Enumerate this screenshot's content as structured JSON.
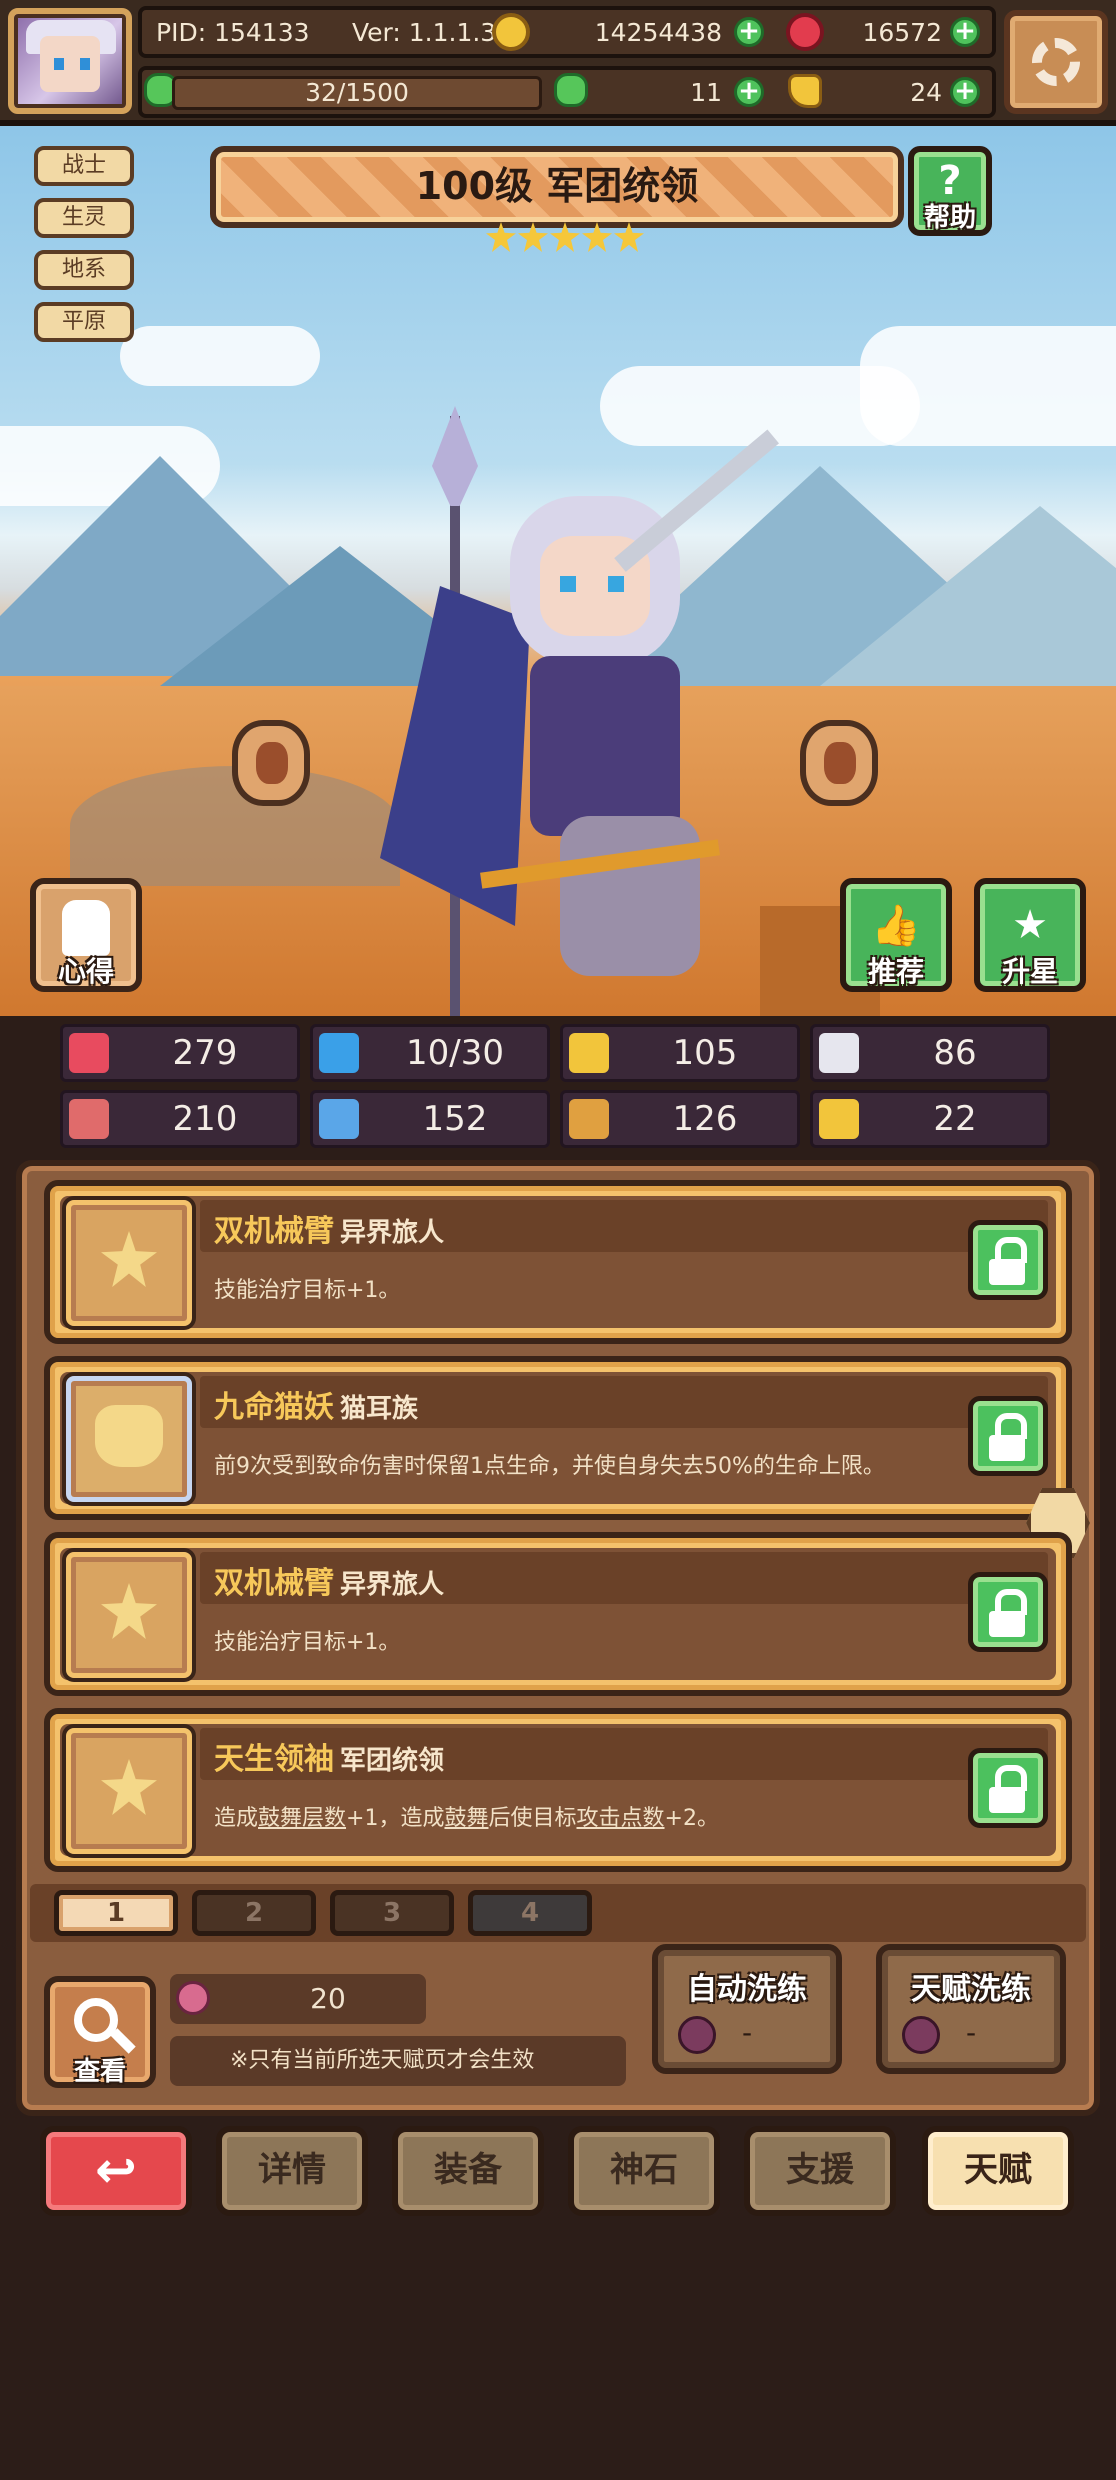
{
  "topbar": {
    "pid": "PID: 154133",
    "version": "Ver: 1.1.1.3",
    "gold": "14254438",
    "gems": "16572",
    "exp": "32/1500",
    "clover": "11",
    "tickets": "24"
  },
  "tags": [
    "战士",
    "生灵",
    "地系",
    "平原"
  ],
  "hero": {
    "title": "100级  军团统领",
    "stars": 5
  },
  "scene_buttons": {
    "help": "帮助",
    "insight": "心得",
    "recommend": "推荐",
    "star_up": "升星",
    "help_icon": "?",
    "recommend_icon": "👍",
    "star_up_icon": "★"
  },
  "stats": [
    {
      "icon": "heart-icon",
      "value": "279",
      "color": "#e84b5f"
    },
    {
      "icon": "water-drop-icon",
      "value": "10/30",
      "color": "#3aa0e8"
    },
    {
      "icon": "shield-icon",
      "value": "105",
      "color": "#f2c53b"
    },
    {
      "icon": "wing-icon",
      "value": "86",
      "color": "#e6e6ee"
    },
    {
      "icon": "fist-icon",
      "value": "210",
      "color": "#e06b6b"
    },
    {
      "icon": "spellbook-icon",
      "value": "152",
      "color": "#5aa6e8"
    },
    {
      "icon": "boot-icon",
      "value": "126",
      "color": "#e0a040"
    },
    {
      "icon": "horseshoe-icon",
      "value": "22",
      "color": "#f2c53b"
    }
  ],
  "talents": [
    {
      "name": "双机械臂",
      "race": "异界旅人",
      "desc": "技能治疗目标+1。",
      "icon": "star-icon"
    },
    {
      "name": "九命猫妖",
      "race": "猫耳族",
      "desc": "前9次受到致命伤害时保留1点生命，并使自身失去50%的生命上限。",
      "icon": "cat-icon"
    },
    {
      "name": "双机械臂",
      "race": "异界旅人",
      "desc": "技能治疗目标+1。",
      "icon": "star-icon"
    },
    {
      "name": "天生领袖",
      "race": "军团统领",
      "desc_parts": [
        "造成",
        "鼓舞层数",
        "+1，造成",
        "鼓舞",
        "后使目标",
        "攻击点数",
        "+2。"
      ],
      "icon": "star-icon"
    }
  ],
  "pages": [
    "1",
    "2",
    "3",
    "4"
  ],
  "bottom_panel": {
    "view_label": "查看",
    "fruit_count": "20",
    "note": "※只有当前所选天赋页才会生效",
    "auto_wash": "自动洗练",
    "auto_wash_cost": "-",
    "talent_wash": "天赋洗练",
    "talent_wash_cost": "-"
  },
  "nav": {
    "back_icon": "↩",
    "details": "详情",
    "equipment": "装备",
    "godstone": "神石",
    "support": "支援",
    "talent": "天赋"
  }
}
